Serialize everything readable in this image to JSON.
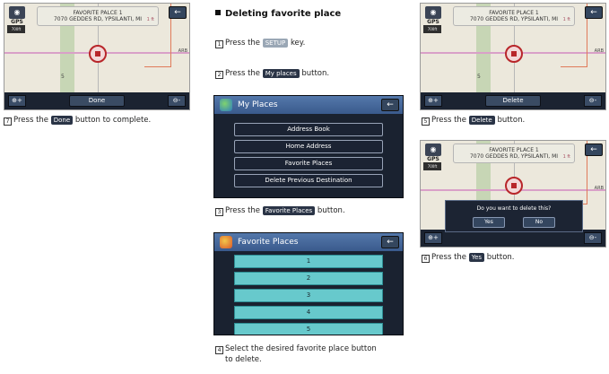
{
  "section_title": "Deleting favorite place",
  "gps_label": "GPS",
  "gps_zoom": "700ft",
  "arrow_glyph": "←",
  "zoom_in_label": "⊕+",
  "zoom_out_label": "⊖-",
  "map_labels": {
    "road_right": "ARB",
    "road_num": "5"
  },
  "screens": {
    "top_left": {
      "addr1": "FAVORITE PALCE 1",
      "addr2": "7070 GEDDES RD, YPSILANTI, MI",
      "dist": "1 ft",
      "button": "Done"
    },
    "top_right": {
      "addr1": "FAVORITE PLACE 1",
      "addr2": "7070 GEDDES RD, YPSILANTI, MI",
      "dist": "1 ft",
      "button": "Delete"
    },
    "mid_right": {
      "addr1": "FAVORITE PLACE 1",
      "addr2": "7070 GEDDES RD, YPSILANTI, MI",
      "dist": "1 ft",
      "dialog_question": "Do you want to delete this?",
      "yes": "Yes",
      "no": "No"
    }
  },
  "my_places": {
    "title": "My Places",
    "items": [
      "Address Book",
      "Home Address",
      "Favorite Places",
      "Delete Previous Destination"
    ]
  },
  "favorite_places": {
    "title": "Favorite Places",
    "items": [
      "1",
      "2",
      "3",
      "4",
      "5"
    ]
  },
  "steps": {
    "s7": {
      "num": "7",
      "pre": "Press the",
      "pill": "Done",
      "post": "button to complete."
    },
    "s1": {
      "num": "1",
      "pre": "Press the",
      "pill": "SETUP",
      "post": "key."
    },
    "s2": {
      "num": "2",
      "pre": "Press the",
      "pill": "My places",
      "post": "button."
    },
    "s3": {
      "num": "3",
      "pre": "Press the",
      "pill": "Favorite Places",
      "post": "button."
    },
    "s4": {
      "num": "4",
      "line1": "Select the desired favorite place button",
      "line2": "to delete."
    },
    "s5": {
      "num": "5",
      "pre": "Press the",
      "pill": "Delete",
      "post": "button."
    },
    "s6": {
      "num": "6",
      "pre": "Press the",
      "pill": "Yes",
      "post": "button."
    }
  },
  "colors": {
    "screen_bg": "#1a2230",
    "header_blue": "#3a5a8c",
    "fav_cyan": "#67c9cc",
    "map_bg": "#ece8dc",
    "marker_red": "#b8262a"
  }
}
